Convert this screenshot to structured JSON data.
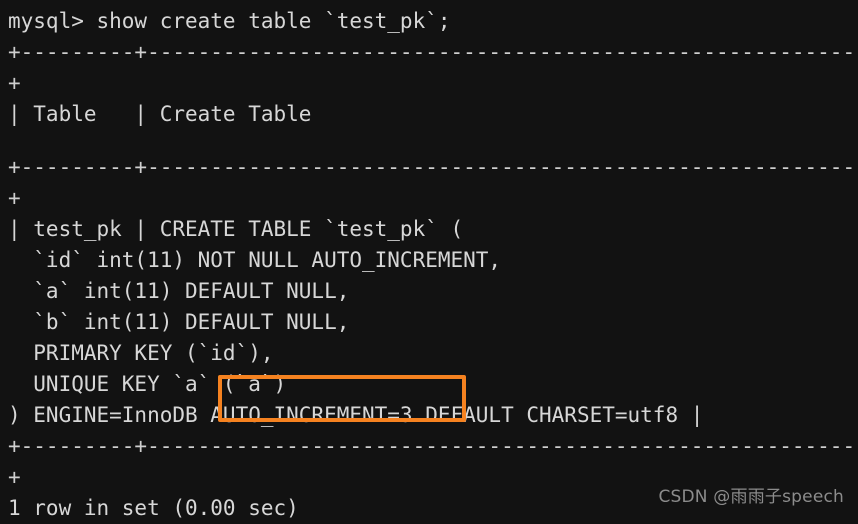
{
  "terminal": {
    "prompt_line": "mysql> show create table `test_pk`;",
    "separator_top": "+---------+------------------------------------------------------------------------------------------------------------------------------+",
    "header_row": "| Table   | Create Table",
    "separator_mid": "+---------+------------------------------------------------------------------------------------------------------------------------------+",
    "body": [
      "| test_pk | CREATE TABLE `test_pk` (",
      "  `id` int(11) NOT NULL AUTO_INCREMENT,",
      "  `a` int(11) DEFAULT NULL,",
      "  `b` int(11) DEFAULT NULL,",
      "  PRIMARY KEY (`id`),",
      "  UNIQUE KEY `a` (`a`)",
      ") ENGINE=InnoDB AUTO_INCREMENT=3 DEFAULT CHARSET=utf8 |"
    ],
    "separator_bottom": "+---------+------------------------------------------------------------------------------------------------------------------------------+",
    "status_line": "1 row in set (0.00 sec)",
    "colors": {
      "background": "#121212",
      "text": "#d7d7d7",
      "highlight": "#f58220",
      "watermark": "#8c8c8c"
    }
  },
  "annotation": {
    "highlight_target": "AUTO_INCREMENT=3",
    "highlight_color": "#f58220"
  },
  "watermark": {
    "text": "CSDN @雨雨子speech"
  }
}
